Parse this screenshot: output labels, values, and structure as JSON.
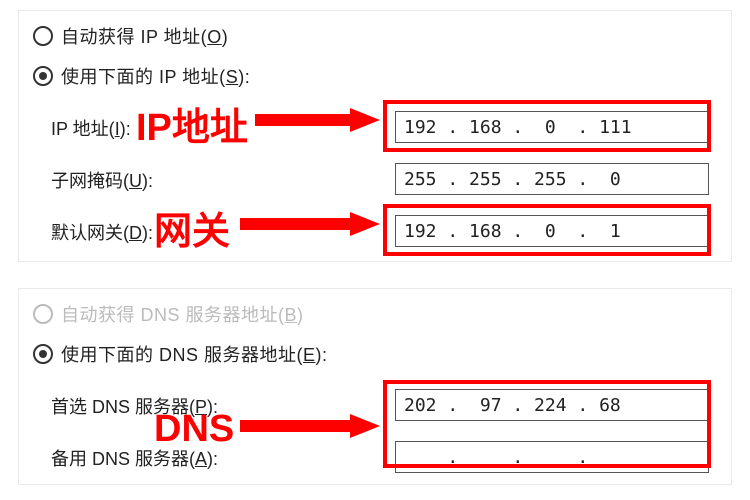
{
  "ip_section": {
    "radio_auto": {
      "pre": "自动获得 IP 地址(",
      "ul": "O",
      "post": ")"
    },
    "radio_manual": {
      "pre": "使用下面的 IP 地址(",
      "ul": "S",
      "post": "):"
    },
    "ip_label": {
      "pre": "IP 地址(",
      "ul": "I",
      "post": "):"
    },
    "mask_label": {
      "pre": "子网掩码(",
      "ul": "U",
      "post": "):"
    },
    "gw_label": {
      "pre": "默认网关(",
      "ul": "D",
      "post": "):"
    },
    "ip_value": "192 . 168 .  0  . 111",
    "mask_value": "255 . 255 . 255 .  0",
    "gw_value": "192 . 168 .  0  .  1"
  },
  "dns_section": {
    "radio_auto": {
      "pre": "自动获得 DNS 服务器地址(",
      "ul": "B",
      "post": ")"
    },
    "radio_manual": {
      "pre": "使用下面的 DNS 服务器地址(",
      "ul": "E",
      "post": "):"
    },
    "pref_label": {
      "pre": "首选 DNS 服务器(",
      "ul": "P",
      "post": "):"
    },
    "alt_label": {
      "pre": "备用 DNS 服务器(",
      "ul": "A",
      "post": "):"
    },
    "pref_value": "202 .  97 . 224 . 68",
    "alt_value": "    .     .     .   "
  },
  "annotations": {
    "ip": "IP地址",
    "gw": "网关",
    "dns": "DNS"
  }
}
